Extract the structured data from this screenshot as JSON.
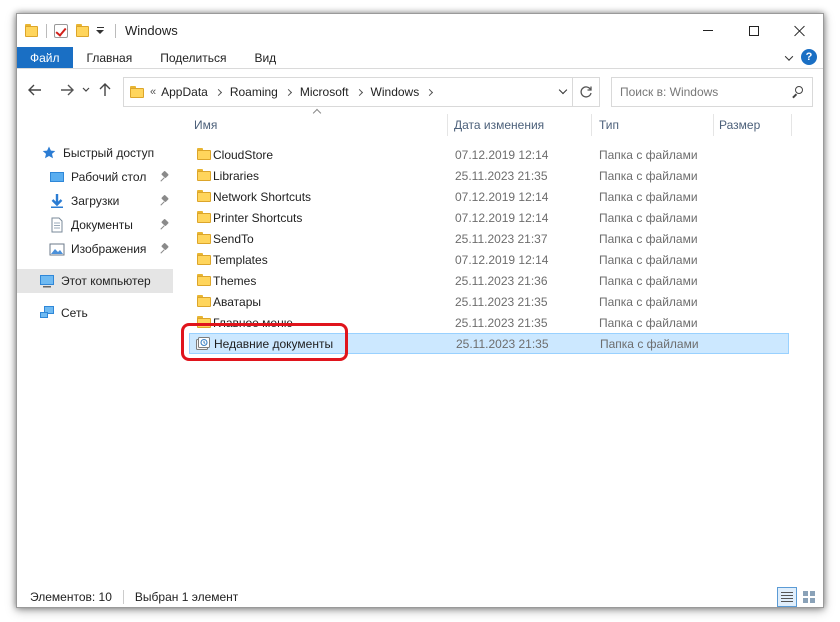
{
  "window": {
    "title": "Windows"
  },
  "ribbon": {
    "tabs": [
      "Файл",
      "Главная",
      "Поделиться",
      "Вид"
    ],
    "help": "?"
  },
  "address": {
    "overflow": "«",
    "crumbs": [
      "AppData",
      "Roaming",
      "Microsoft",
      "Windows"
    ],
    "search_placeholder": "Поиск в: Windows"
  },
  "sidebar": {
    "items": [
      {
        "label": "Быстрый доступ",
        "icon": "star-icon"
      },
      {
        "label": "Рабочий стол",
        "icon": "desktop-icon",
        "pinned": true
      },
      {
        "label": "Загрузки",
        "icon": "download-icon",
        "pinned": true
      },
      {
        "label": "Документы",
        "icon": "document-icon",
        "pinned": true
      },
      {
        "label": "Изображения",
        "icon": "picture-icon",
        "pinned": true
      },
      {
        "label": "Этот компьютер",
        "icon": "computer-icon",
        "selected": true
      },
      {
        "label": "Сеть",
        "icon": "network-icon"
      }
    ]
  },
  "columns": {
    "name": "Имя",
    "date": "Дата изменения",
    "type": "Тип",
    "size": "Размер"
  },
  "files": [
    {
      "name": "CloudStore",
      "date": "07.12.2019 12:14",
      "type": "Папка с файлами"
    },
    {
      "name": "Libraries",
      "date": "25.11.2023 21:35",
      "type": "Папка с файлами"
    },
    {
      "name": "Network Shortcuts",
      "date": "07.12.2019 12:14",
      "type": "Папка с файлами"
    },
    {
      "name": "Printer Shortcuts",
      "date": "07.12.2019 12:14",
      "type": "Папка с файлами"
    },
    {
      "name": "SendTo",
      "date": "25.11.2023 21:37",
      "type": "Папка с файлами"
    },
    {
      "name": "Templates",
      "date": "07.12.2019 12:14",
      "type": "Папка с файлами"
    },
    {
      "name": "Themes",
      "date": "25.11.2023 21:36",
      "type": "Папка с файлами"
    },
    {
      "name": "Аватары",
      "date": "25.11.2023 21:35",
      "type": "Папка с файлами"
    },
    {
      "name": "Главное меню",
      "date": "25.11.2023 21:35",
      "type": "Папка с файлами"
    },
    {
      "name": "Недавние документы",
      "date": "25.11.2023 21:35",
      "type": "Папка с файлами",
      "selected": true
    }
  ],
  "status": {
    "count": "Элементов: 10",
    "selection": "Выбран 1 элемент"
  },
  "colors": {
    "accent": "#1a6fc4",
    "selection": "#cce8ff",
    "highlight": "#e0141c"
  }
}
